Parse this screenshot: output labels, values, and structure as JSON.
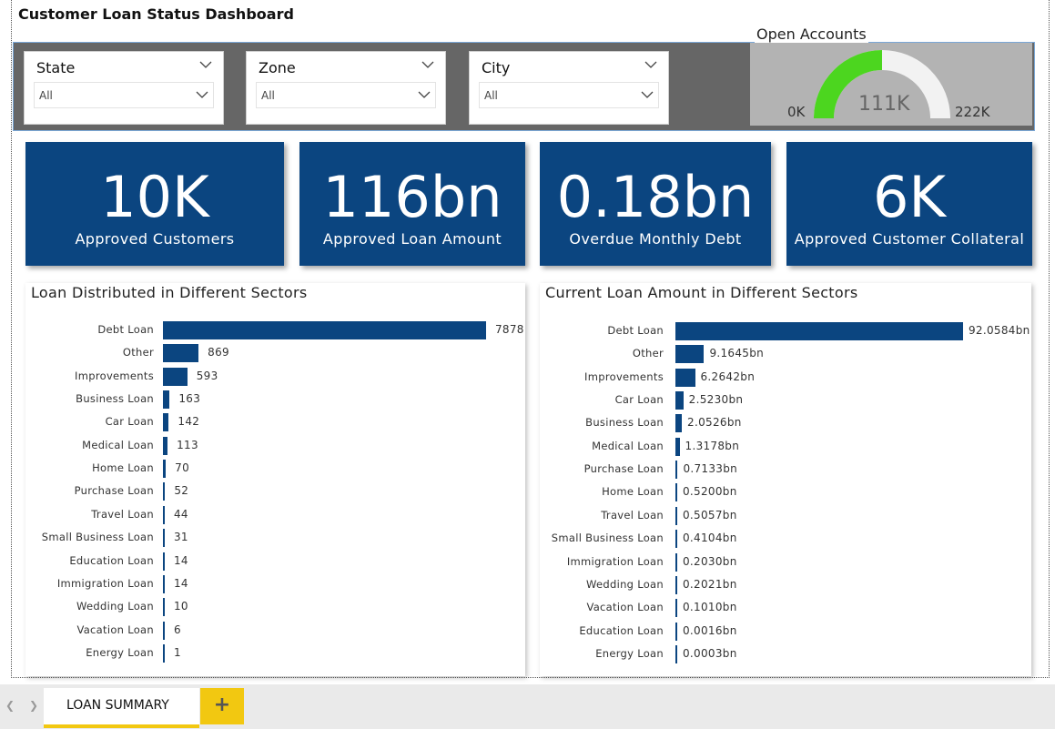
{
  "dashboard": {
    "title": "Customer Loan Status Dashboard"
  },
  "filters": [
    {
      "label": "State",
      "value": "All"
    },
    {
      "label": "Zone",
      "value": "All"
    },
    {
      "label": "City",
      "value": "All"
    }
  ],
  "gauge": {
    "title": "Open Accounts",
    "min_label": "0K",
    "max_label": "222K",
    "value_label": "111K",
    "min": 0,
    "max": 222000,
    "value": 111000,
    "fill_color": "#4cd61f",
    "track_color": "#f2f2f2"
  },
  "cards": [
    {
      "value": "10K",
      "label": "Approved Customers"
    },
    {
      "value": "116bn",
      "label": "Approved Loan Amount"
    },
    {
      "value": "0.18bn",
      "label": "Overdue Monthly Debt"
    },
    {
      "value": "6K",
      "label": "Approved Customer Collateral"
    }
  ],
  "colors": {
    "accent": "#0b4580",
    "tab_accent": "#f2c811",
    "filter_band": "#666666"
  },
  "chart_data": [
    {
      "type": "bar",
      "orientation": "horizontal",
      "title": "Loan Distributed in Different Sectors",
      "categories": [
        "Debt Loan",
        "Other",
        "Improvements",
        "Business Loan",
        "Car Loan",
        "Medical Loan",
        "Home Loan",
        "Purchase Loan",
        "Travel Loan",
        "Small Business Loan",
        "Education Loan",
        "Immigration Loan",
        "Wedding Loan",
        "Vacation Loan",
        "Energy Loan"
      ],
      "values": [
        7878,
        869,
        593,
        163,
        142,
        113,
        70,
        52,
        44,
        31,
        14,
        14,
        10,
        6,
        1
      ],
      "labels": [
        "7878",
        "869",
        "593",
        "163",
        "142",
        "113",
        "70",
        "52",
        "44",
        "31",
        "14",
        "14",
        "10",
        "6",
        "1"
      ],
      "grid": false
    },
    {
      "type": "bar",
      "orientation": "horizontal",
      "title": "Current Loan Amount in Different Sectors",
      "categories": [
        "Debt Loan",
        "Other",
        "Improvements",
        "Car Loan",
        "Business Loan",
        "Medical Loan",
        "Purchase Loan",
        "Home Loan",
        "Travel Loan",
        "Small Business Loan",
        "Immigration Loan",
        "Wedding Loan",
        "Vacation Loan",
        "Education Loan",
        "Energy Loan"
      ],
      "values": [
        92.0584,
        9.1645,
        6.2642,
        2.523,
        2.0526,
        1.3178,
        0.7133,
        0.52,
        0.5057,
        0.4104,
        0.203,
        0.2021,
        0.101,
        0.0016,
        0.0003
      ],
      "labels": [
        "92.0584bn",
        "9.1645bn",
        "6.2642bn",
        "2.5230bn",
        "2.0526bn",
        "1.3178bn",
        "0.7133bn",
        "0.5200bn",
        "0.5057bn",
        "0.4104bn",
        "0.2030bn",
        "0.2021bn",
        "0.1010bn",
        "0.0016bn",
        "0.0003bn"
      ],
      "grid": false
    }
  ],
  "tabs": {
    "active": "LOAN SUMMARY",
    "add": "+"
  }
}
